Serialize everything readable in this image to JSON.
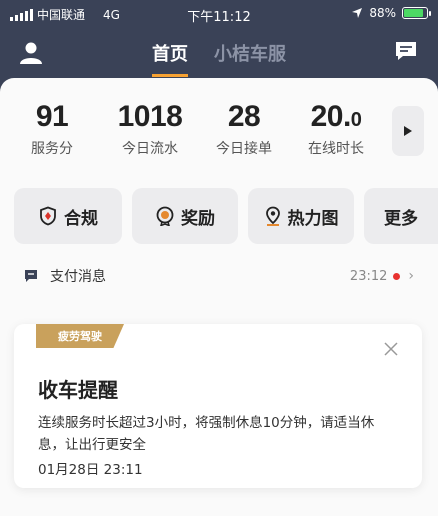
{
  "status_bar": {
    "carrier": "中国联通",
    "network": "4G",
    "time": "下午11:12",
    "battery_text": "88%",
    "battery_level": 0.88
  },
  "nav": {
    "tabs": [
      {
        "label": "首页",
        "active": true
      },
      {
        "label": "小桔车服",
        "active": false
      }
    ]
  },
  "stats": [
    {
      "value": "91",
      "label": "服务分"
    },
    {
      "value": "1018",
      "label": "今日流水"
    },
    {
      "value": "28",
      "label": "今日接单"
    },
    {
      "value_main": "20.",
      "value_small": "0",
      "label": "在线时长"
    }
  ],
  "quick_actions": [
    {
      "label": "合规",
      "icon": "shield-icon"
    },
    {
      "label": "奖励",
      "icon": "reward-medal-icon"
    },
    {
      "label": "热力图",
      "icon": "map-pin-icon"
    },
    {
      "label": "更多",
      "icon": ""
    }
  ],
  "notice": {
    "title": "支付消息",
    "time": "23:12"
  },
  "alert": {
    "tag": "疲劳驾驶",
    "title": "收车提醒",
    "body": "连续服务时长超过3小时，将强制休息10分钟，请适当休息，让出行更安全",
    "date": "01月28日 23:11"
  },
  "colors": {
    "header_bg": "#3a4257",
    "tab_underline": "#f7a233",
    "tag_bg": "#c9a15c",
    "dot_red": "#e8312f",
    "shield_red": "#d9342b",
    "reward_orange": "#e5892f"
  }
}
